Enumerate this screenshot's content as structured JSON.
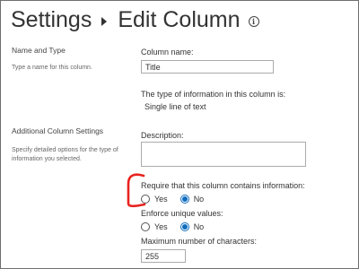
{
  "header": {
    "breadcrumb_root": "Settings",
    "page_title": "Edit Column",
    "info_glyph": "i"
  },
  "name_section": {
    "title": "Name and Type",
    "description": "Type a name for this column.",
    "column_name_label": "Column name:",
    "column_name_value": "Title",
    "type_label": "The type of information in this column is:",
    "type_value": "Single line of text"
  },
  "additional_section": {
    "title": "Additional Column Settings",
    "description": "Specify detailed options for the type of information you selected.",
    "description_label": "Description:",
    "description_value": "",
    "require_label": "Require that this column contains information:",
    "require_options": [
      {
        "label": "Yes",
        "checked": false
      },
      {
        "label": "No",
        "checked": true
      }
    ],
    "unique_label": "Enforce unique values:",
    "unique_options": [
      {
        "label": "Yes",
        "checked": false
      },
      {
        "label": "No",
        "checked": true
      }
    ],
    "max_chars_label": "Maximum number of characters:",
    "max_chars_value": "255"
  },
  "annotation": {
    "color": "#e8231f"
  },
  "colors": {
    "radio_selected": "#0f6cbd"
  },
  "icons": [
    "chevron-right-icon",
    "info-icon"
  ]
}
